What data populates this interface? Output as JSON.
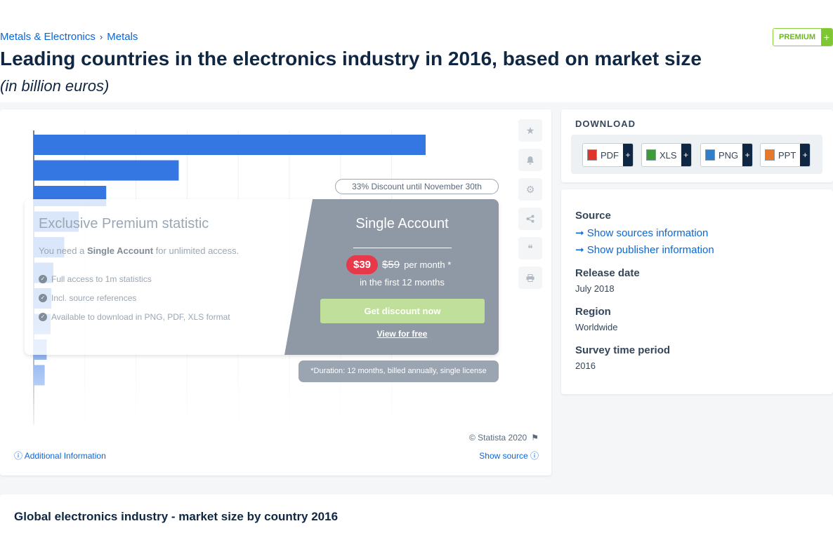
{
  "breadcrumb": {
    "items": [
      "Metals & Electronics",
      "Metals"
    ],
    "separator": "›"
  },
  "premium_badge": {
    "label": "PREMIUM",
    "plus": "+"
  },
  "page": {
    "title": "Leading countries in the electronics industry in 2016, based on market size",
    "subtitle": "(in billion euros)"
  },
  "chart_data": {
    "type": "bar",
    "orientation": "horizontal",
    "categories": [],
    "values": [
      100,
      37,
      18.5,
      11.5,
      7.8,
      5,
      4.5,
      4.3,
      3.3,
      2.8
    ],
    "bar_color": "#3476e2",
    "grid": true,
    "obscured_by_paywall": true
  },
  "paywall": {
    "discount": "33% Discount until November 30th",
    "title": "Exclusive Premium statistic",
    "need_prefix": "You need a ",
    "need_bold": "Single Account",
    "need_suffix": " for unlimited access.",
    "features": [
      "Full access to 1m statistics",
      "Incl. source references",
      "Available to download in PNG, PDF, XLS format"
    ],
    "plan_title": "Single Account",
    "price_new": "$39",
    "price_old": "$59",
    "price_per": "per month *",
    "price_first": "in the first 12 months",
    "cta": "Get discount now",
    "view_free": "View for free",
    "duration": "*Duration: 12 months, billed annually, single license"
  },
  "chart_footer": {
    "copyright": "© Statista 2020",
    "additional_info": "Additional Information",
    "show_source": "Show source"
  },
  "download": {
    "heading": "DOWNLOAD",
    "buttons": [
      {
        "label": "PDF",
        "icon": "pdf-file-icon",
        "color": "#e0352b"
      },
      {
        "label": "XLS",
        "icon": "xls-file-icon",
        "color": "#3e9b3a"
      },
      {
        "label": "PNG",
        "icon": "png-file-icon",
        "color": "#2f7fc9"
      },
      {
        "label": "PPT",
        "icon": "ppt-file-icon",
        "color": "#e8792b"
      }
    ],
    "plus": "+"
  },
  "info": {
    "source_heading": "Source",
    "source_link": "Show sources information",
    "publisher_link": "Show publisher information",
    "release_heading": "Release date",
    "release_value": "July 2018",
    "region_heading": "Region",
    "region_value": "Worldwide",
    "survey_heading": "Survey time period",
    "survey_value": "2016"
  },
  "bottom": {
    "title": "Global electronics industry - market size by country 2016"
  }
}
